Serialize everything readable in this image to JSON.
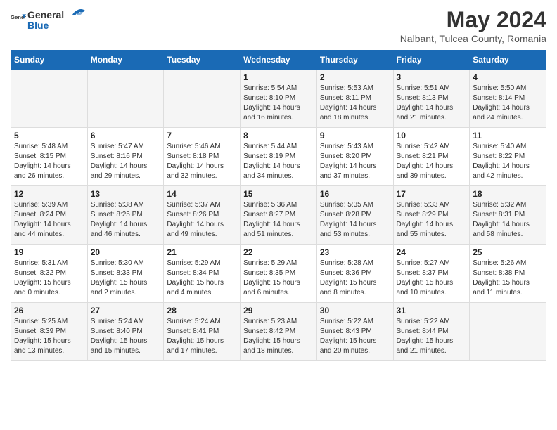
{
  "logo": {
    "general": "General",
    "blue": "Blue"
  },
  "title": "May 2024",
  "subtitle": "Nalbant, Tulcea County, Romania",
  "days_of_week": [
    "Sunday",
    "Monday",
    "Tuesday",
    "Wednesday",
    "Thursday",
    "Friday",
    "Saturday"
  ],
  "weeks": [
    [
      {
        "day": "",
        "info": ""
      },
      {
        "day": "",
        "info": ""
      },
      {
        "day": "",
        "info": ""
      },
      {
        "day": "1",
        "info": "Sunrise: 5:54 AM\nSunset: 8:10 PM\nDaylight: 14 hours and 16 minutes."
      },
      {
        "day": "2",
        "info": "Sunrise: 5:53 AM\nSunset: 8:11 PM\nDaylight: 14 hours and 18 minutes."
      },
      {
        "day": "3",
        "info": "Sunrise: 5:51 AM\nSunset: 8:13 PM\nDaylight: 14 hours and 21 minutes."
      },
      {
        "day": "4",
        "info": "Sunrise: 5:50 AM\nSunset: 8:14 PM\nDaylight: 14 hours and 24 minutes."
      }
    ],
    [
      {
        "day": "5",
        "info": "Sunrise: 5:48 AM\nSunset: 8:15 PM\nDaylight: 14 hours and 26 minutes."
      },
      {
        "day": "6",
        "info": "Sunrise: 5:47 AM\nSunset: 8:16 PM\nDaylight: 14 hours and 29 minutes."
      },
      {
        "day": "7",
        "info": "Sunrise: 5:46 AM\nSunset: 8:18 PM\nDaylight: 14 hours and 32 minutes."
      },
      {
        "day": "8",
        "info": "Sunrise: 5:44 AM\nSunset: 8:19 PM\nDaylight: 14 hours and 34 minutes."
      },
      {
        "day": "9",
        "info": "Sunrise: 5:43 AM\nSunset: 8:20 PM\nDaylight: 14 hours and 37 minutes."
      },
      {
        "day": "10",
        "info": "Sunrise: 5:42 AM\nSunset: 8:21 PM\nDaylight: 14 hours and 39 minutes."
      },
      {
        "day": "11",
        "info": "Sunrise: 5:40 AM\nSunset: 8:22 PM\nDaylight: 14 hours and 42 minutes."
      }
    ],
    [
      {
        "day": "12",
        "info": "Sunrise: 5:39 AM\nSunset: 8:24 PM\nDaylight: 14 hours and 44 minutes."
      },
      {
        "day": "13",
        "info": "Sunrise: 5:38 AM\nSunset: 8:25 PM\nDaylight: 14 hours and 46 minutes."
      },
      {
        "day": "14",
        "info": "Sunrise: 5:37 AM\nSunset: 8:26 PM\nDaylight: 14 hours and 49 minutes."
      },
      {
        "day": "15",
        "info": "Sunrise: 5:36 AM\nSunset: 8:27 PM\nDaylight: 14 hours and 51 minutes."
      },
      {
        "day": "16",
        "info": "Sunrise: 5:35 AM\nSunset: 8:28 PM\nDaylight: 14 hours and 53 minutes."
      },
      {
        "day": "17",
        "info": "Sunrise: 5:33 AM\nSunset: 8:29 PM\nDaylight: 14 hours and 55 minutes."
      },
      {
        "day": "18",
        "info": "Sunrise: 5:32 AM\nSunset: 8:31 PM\nDaylight: 14 hours and 58 minutes."
      }
    ],
    [
      {
        "day": "19",
        "info": "Sunrise: 5:31 AM\nSunset: 8:32 PM\nDaylight: 15 hours and 0 minutes."
      },
      {
        "day": "20",
        "info": "Sunrise: 5:30 AM\nSunset: 8:33 PM\nDaylight: 15 hours and 2 minutes."
      },
      {
        "day": "21",
        "info": "Sunrise: 5:29 AM\nSunset: 8:34 PM\nDaylight: 15 hours and 4 minutes."
      },
      {
        "day": "22",
        "info": "Sunrise: 5:29 AM\nSunset: 8:35 PM\nDaylight: 15 hours and 6 minutes."
      },
      {
        "day": "23",
        "info": "Sunrise: 5:28 AM\nSunset: 8:36 PM\nDaylight: 15 hours and 8 minutes."
      },
      {
        "day": "24",
        "info": "Sunrise: 5:27 AM\nSunset: 8:37 PM\nDaylight: 15 hours and 10 minutes."
      },
      {
        "day": "25",
        "info": "Sunrise: 5:26 AM\nSunset: 8:38 PM\nDaylight: 15 hours and 11 minutes."
      }
    ],
    [
      {
        "day": "26",
        "info": "Sunrise: 5:25 AM\nSunset: 8:39 PM\nDaylight: 15 hours and 13 minutes."
      },
      {
        "day": "27",
        "info": "Sunrise: 5:24 AM\nSunset: 8:40 PM\nDaylight: 15 hours and 15 minutes."
      },
      {
        "day": "28",
        "info": "Sunrise: 5:24 AM\nSunset: 8:41 PM\nDaylight: 15 hours and 17 minutes."
      },
      {
        "day": "29",
        "info": "Sunrise: 5:23 AM\nSunset: 8:42 PM\nDaylight: 15 hours and 18 minutes."
      },
      {
        "day": "30",
        "info": "Sunrise: 5:22 AM\nSunset: 8:43 PM\nDaylight: 15 hours and 20 minutes."
      },
      {
        "day": "31",
        "info": "Sunrise: 5:22 AM\nSunset: 8:44 PM\nDaylight: 15 hours and 21 minutes."
      },
      {
        "day": "",
        "info": ""
      }
    ]
  ]
}
